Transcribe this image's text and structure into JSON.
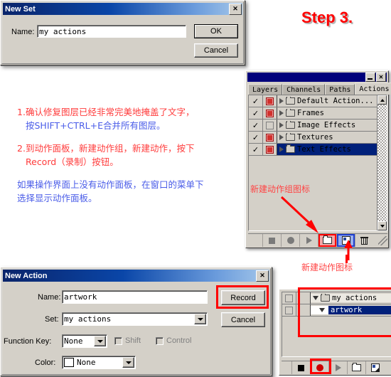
{
  "headline": "Step 3.",
  "new_set_dialog": {
    "title": "New Set",
    "close_label": "✕",
    "name_label": "Name:",
    "name_value": "my actions",
    "ok_label": "OK",
    "cancel_label": "Cancel"
  },
  "instructions": {
    "item1_num": "1.",
    "item1_line1": "确认修复图层已经非常完美地掩盖了文字，",
    "item1_line2": "按SHIFT+CTRL+E合并所有图层。",
    "item2_num": "2.",
    "item2_line1": "到动作面板，新建动作组，新建动作，按下",
    "item2_line2": "Record（录制）按钮。",
    "item3_line1": "如果操作界面上没有动作面板，在窗口的菜单下",
    "item3_line2": "选择显示动作面板。"
  },
  "actions_palette": {
    "close_label": "✕",
    "tabs": [
      {
        "label": "Layers",
        "active": false
      },
      {
        "label": "Channels",
        "active": false
      },
      {
        "label": "Paths",
        "active": false
      },
      {
        "label": "Actions",
        "active": true
      }
    ],
    "rows": [
      {
        "name": "Default Action...",
        "checked": true,
        "second_box": "red",
        "selected": false
      },
      {
        "name": "Frames",
        "checked": true,
        "second_box": "red",
        "selected": false
      },
      {
        "name": "Image Effects",
        "checked": true,
        "second_box": "empty",
        "selected": false
      },
      {
        "name": "Textures",
        "checked": true,
        "second_box": "red",
        "selected": false
      },
      {
        "name": "Text Effects",
        "checked": true,
        "second_box": "red",
        "selected": true
      }
    ],
    "check_glyph": "✓",
    "toolbar": [
      {
        "icon": "stop-icon",
        "highlight": "none"
      },
      {
        "icon": "record-icon",
        "highlight": "none"
      },
      {
        "icon": "play-icon",
        "highlight": "none"
      },
      {
        "icon": "new-set-folder-icon",
        "highlight": "red"
      },
      {
        "icon": "new-action-icon",
        "highlight": "blue"
      },
      {
        "icon": "trash-icon",
        "highlight": "none"
      }
    ]
  },
  "annotations": {
    "new_set_icon_label": "新建动作组图标",
    "new_action_icon_label": "新建动作图标"
  },
  "new_action_dialog": {
    "title": "New Action",
    "close_label": "✕",
    "name_label": "Name:",
    "name_value": "artwork",
    "set_label": "Set:",
    "set_value": "my actions",
    "function_key_label": "Function Key:",
    "function_key_value": "None",
    "shift_label": "Shift",
    "control_label": "Control",
    "color_label": "Color:",
    "color_value": "None",
    "record_label": "Record",
    "cancel_label": "Cancel"
  },
  "result_palette": {
    "rows": [
      {
        "name": "my actions",
        "type": "set",
        "selected": false
      },
      {
        "name": "artwork",
        "type": "action",
        "selected": true
      }
    ],
    "toolbar": [
      {
        "icon": "stop-icon",
        "highlight": "none"
      },
      {
        "icon": "record-icon",
        "highlight": "red"
      },
      {
        "icon": "play-icon",
        "highlight": "none"
      },
      {
        "icon": "new-set-folder-icon",
        "highlight": "none"
      },
      {
        "icon": "new-action-icon",
        "highlight": "none"
      }
    ]
  },
  "colors": {
    "accent_red": "#ff0000",
    "annotation_red": "#ff4444",
    "instruction_red": "#ff3b3b",
    "instruction_blue": "#4a5ce8",
    "title_blue": "#0a246a",
    "palette_title": "#00007b",
    "selection_blue": "#00207a",
    "chrome": "#d4d0c8"
  }
}
